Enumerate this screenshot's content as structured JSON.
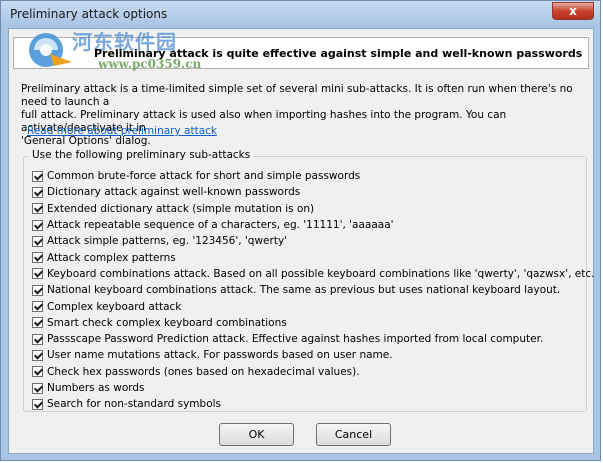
{
  "window": {
    "title": "Preliminary attack options",
    "close_glyph": "x"
  },
  "header": {
    "text": "Preliminary attack is quite effective against simple and well-known passwords",
    "watermark_cn": "河东软件园",
    "watermark_url": "www.pc0359.cn"
  },
  "description": {
    "line1": "Preliminary attack is a time-limited simple set of several mini sub-attacks. It is often run when there's no need to launch a",
    "line2": "full attack. Preliminary attack is used also when importing hashes into the program. You can activate/deactivate it in",
    "line3": "'General Options' dialog."
  },
  "link": {
    "text": "Read more about preliminary attack"
  },
  "group": {
    "label": "Use the following preliminary sub-attacks",
    "items": [
      {
        "label": "Common brute-force attack for short and simple passwords",
        "checked": true
      },
      {
        "label": "Dictionary attack against well-known passwords",
        "checked": true
      },
      {
        "label": "Extended dictionary attack (simple mutation is on)",
        "checked": true
      },
      {
        "label": "Attack repeatable sequence of a characters, eg. '11111', 'aaaaaa'",
        "checked": true
      },
      {
        "label": "Attack simple patterns, eg. '123456', 'qwerty'",
        "checked": true
      },
      {
        "label": "Attack complex patterns",
        "checked": true
      },
      {
        "label": "Keyboard combinations attack. Based on all possible keyboard combinations like 'qwerty', 'qazwsx', etc.",
        "checked": true
      },
      {
        "label": "National keyboard combinations attack. The same as previous but uses national keyboard layout.",
        "checked": true
      },
      {
        "label": "Complex keyboard attack",
        "checked": true
      },
      {
        "label": "Smart check complex keyboard combinations",
        "checked": true
      },
      {
        "label": "Passscape Password Prediction attack. Effective against hashes imported from local computer.",
        "checked": true
      },
      {
        "label": "User name mutations attack. For passwords based on user name.",
        "checked": true
      },
      {
        "label": "Check hex passwords (ones based on hexadecimal values).",
        "checked": true
      },
      {
        "label": "Numbers as words",
        "checked": true
      },
      {
        "label": "Search for non-standard symbols",
        "checked": true
      }
    ]
  },
  "buttons": {
    "ok": "OK",
    "cancel": "Cancel"
  },
  "colors": {
    "title_bar": "#a7c3e4",
    "close_button": "#c7432f",
    "link": "#0b5fc6",
    "dialog_bg": "#f0f0f0"
  }
}
